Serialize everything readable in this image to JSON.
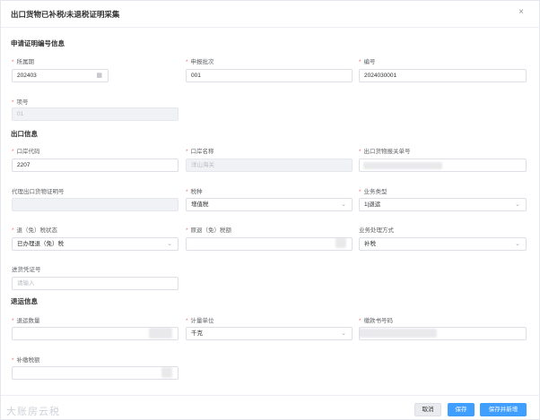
{
  "dialog": {
    "title": "出口货物已补税/未退税证明采集",
    "close_icon": "×"
  },
  "sections": {
    "apply": "申请证明编号信息",
    "export": "出口信息",
    "refund": "退运信息"
  },
  "fields": {
    "period": {
      "label": "所属期",
      "value": "202403",
      "icon": "calendar-icon"
    },
    "batch": {
      "label": "申报批次",
      "value": "001"
    },
    "number": {
      "label": "编号",
      "value": "2024030001"
    },
    "item_no": {
      "label": "项号",
      "value": "01"
    },
    "port_code": {
      "label": "口岸代码",
      "value": "2207"
    },
    "port_name": {
      "label": "口岸名称",
      "value": "洋山海关"
    },
    "customs_no": {
      "label": "出口货物报关单号",
      "value": ""
    },
    "agent_cert_no": {
      "label": "代理出口货物证明号",
      "value": ""
    },
    "tax_type": {
      "label": "税种",
      "value": "增值税"
    },
    "biz_type": {
      "label": "业务类型",
      "value": "1|退运"
    },
    "refund_status": {
      "label": "退（免）税状态",
      "value": "已办理退（免）税"
    },
    "orig_tax": {
      "label": "原退（免）税额",
      "value": ""
    },
    "process_method": {
      "label": "业务处理方式",
      "value": "补税"
    },
    "invoice_no": {
      "label": "进货凭证号",
      "placeholder": "请输入"
    },
    "return_qty": {
      "label": "退运数量",
      "value": ""
    },
    "unit": {
      "label": "计量单位",
      "value": "千克"
    },
    "tax_payment_no": {
      "label": "缴款书号码",
      "value": ""
    },
    "back_tax": {
      "label": "补缴税额",
      "value": ""
    }
  },
  "footer": {
    "cancel": "取消",
    "save": "保存",
    "save_new": "保存并新增"
  },
  "watermark": "大账房云税"
}
